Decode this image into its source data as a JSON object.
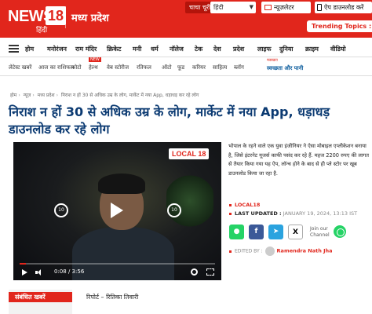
{
  "header": {
    "logo_text": "NEWS",
    "logo_number": "18",
    "logo_sub": "हिंदी",
    "state_title": "मध्य प्रदेश",
    "state_pill": "चाचा चूरी",
    "language_select": "हिंदी",
    "language_options": [
      "हिंदी"
    ],
    "newsletter_label": "न्यूज़लेटर",
    "app_label": "ऐप डाउनलोड करें",
    "trending_label": "Trending Topics :",
    "colors": {
      "brand_red": "#e1261c",
      "headline_blue": "#0b3a72"
    }
  },
  "nav_primary": {
    "items": [
      "होम",
      "मनोरंजन",
      "राम मंदिर",
      "क्रिकेट",
      "मनी",
      "धर्म",
      "नॉलेज",
      "टेक",
      "देश",
      "प्रदेश",
      "लाइफ",
      "दुनिया",
      "क्राइम",
      "वीडियो"
    ]
  },
  "nav_secondary": {
    "items": [
      "लेटेस्ट खबरें",
      "आज का राशिफल",
      "फोटो",
      "हेल्थ",
      "वेब स्टोरीज",
      "रतिफल",
      "ऑटो",
      "फूड",
      "करियर",
      "साहित्य",
      "ब्लॉग"
    ],
    "new_badge": "NEW",
    "promo_sub": "मसखरा",
    "promo": "स्वच्छता और पानी"
  },
  "breadcrumb": [
    "होम",
    "न्यूज़",
    "मध्य प्रदेश",
    "निराश न हों 30 से अधिक उम्र के लोग, मार्केट में नया App, धड़ाधड़ कर रहे लोग"
  ],
  "article": {
    "headline": "निराश न हों 30 से अधिक उम्र के लोग, मार्केट में नया App, धड़ाधड़ डाउनलोड कर रहे लोग",
    "intro": "भोपाल के रहने वाले एक युवा इंजीनियर ने ऐसा मोबाइल एप्लीकेशन बनाया है, जिसे इंटरनेट यूजर्स काफी पसंद कर रहे हैं. महज 2200 रुपए की लागत से तैयार किया गया यह ऐप, लॉन्च होने के बाद से ही प्ले स्टोर पर खूब डाउनलोड किया जा रहा है.",
    "source_tag": "LOCAL18",
    "last_updated_label": "LAST UPDATED :",
    "last_updated_value": "JANUARY 19, 2024, 13:13 IST",
    "share_icons": [
      "whatsapp-icon",
      "facebook-icon",
      "telegram-icon",
      "x-icon"
    ],
    "join_text_1": "Join our",
    "join_text_2": "Channel",
    "edited_by_label": "EDITED BY :",
    "editor_name": "Ramendra Nath Jha",
    "reporter_line": "रिपोर्ट – रितिका तिवारी"
  },
  "video": {
    "watermark": "LOCAL 18",
    "rewind_label": "10",
    "forward_label": "10",
    "current_time": "0:08",
    "duration": "3:56",
    "progress": 0.034
  },
  "related": {
    "heading": "संबंधित खबरें"
  }
}
